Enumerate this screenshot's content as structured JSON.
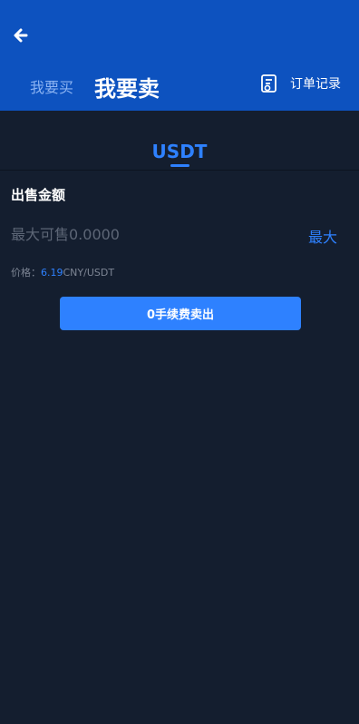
{
  "header": {
    "back_icon": "arrow-left-icon",
    "tab_buy": "我要买",
    "tab_sell": "我要卖",
    "orders_icon": "receipt-icon",
    "orders_label": "订单记录"
  },
  "coin_tabs": {
    "active": "USDT"
  },
  "form": {
    "title": "出售金额",
    "amount_placeholder": "最大可售0.0000",
    "max_label": "最大",
    "price_label": "价格：",
    "price_value": "6.19",
    "price_unit": "CNY/USDT",
    "submit_label": "0手续费卖出"
  },
  "colors": {
    "header_bg": "#0d52bf",
    "page_bg": "#141e2f",
    "accent": "#2e81ff"
  }
}
